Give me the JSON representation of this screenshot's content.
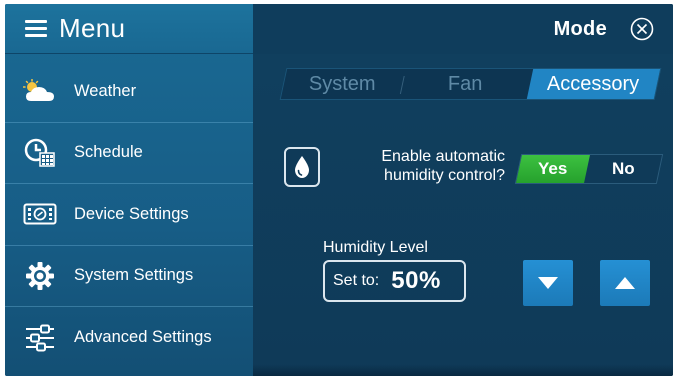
{
  "sidebar": {
    "title": "Menu",
    "items": [
      {
        "label": "Weather",
        "icon": "weather-icon"
      },
      {
        "label": "Schedule",
        "icon": "schedule-icon"
      },
      {
        "label": "Device Settings",
        "icon": "device-settings-icon"
      },
      {
        "label": "System Settings",
        "icon": "gear-icon"
      },
      {
        "label": "Advanced Settings",
        "icon": "sliders-icon"
      }
    ]
  },
  "header": {
    "title": "Mode",
    "close_icon": "close-icon"
  },
  "tabs": [
    {
      "label": "System",
      "active": false
    },
    {
      "label": "Fan",
      "active": false
    },
    {
      "label": "Accessory",
      "active": true
    }
  ],
  "accessory": {
    "enable_label": "Enable automatic humidity control?",
    "toggle": {
      "yes_label": "Yes",
      "no_label": "No",
      "selected": "Yes"
    },
    "humidity_icon": "water-drop-icon",
    "humidity_level_label": "Humidity Level",
    "setpoint_label": "Set to:",
    "setpoint_value": "50%",
    "decrease_icon": "arrow-down-icon",
    "increase_icon": "arrow-up-icon"
  },
  "colors": {
    "sidebar": "#1a6a94",
    "panel": "#0f3f61",
    "accent": "#2185c4",
    "toggle_yes": "#3cc140"
  }
}
